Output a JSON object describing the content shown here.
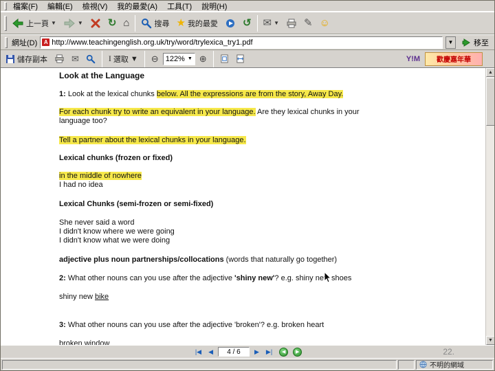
{
  "menu_bar": {
    "items": [
      {
        "label": "檔案(F)"
      },
      {
        "label": "編輯(E)"
      },
      {
        "label": "檢視(V)"
      },
      {
        "label": "我的最愛(A)"
      },
      {
        "label": "工具(T)"
      },
      {
        "label": "說明(H)"
      }
    ]
  },
  "nav_toolbar": {
    "back_label": "上一頁",
    "search_label": "搜尋",
    "favorites_label": "我的最愛"
  },
  "address_bar": {
    "label": "網址(D)",
    "pdf_icon": "A",
    "url": "http://www.teachingenglish.org.uk/try/word/trylexica_try1.pdf",
    "go_label": "移至"
  },
  "pdf_toolbar": {
    "save_label": "儲存副本",
    "select_label": "選取",
    "zoom_value": "122%",
    "ym_label": "Y!M",
    "ad_text": "歡慶嘉年華"
  },
  "pdf_nav": {
    "page_indicator": "4 / 6"
  },
  "slide_number": "22.",
  "status_bar": {
    "zone_text": "不明的網域"
  },
  "document": {
    "lines": [
      {
        "h": 1,
        "mt": 0,
        "runs": [
          {
            "t": "Look at the Language",
            "b": 1
          }
        ]
      },
      {
        "mt": 14,
        "runs": [
          {
            "t": "1: ",
            "b": 1
          },
          {
            "t": "Look at the lexical chunks "
          },
          {
            "t": "below. All the expressions are from the story, Away Day.",
            "hl": 1
          }
        ]
      },
      {
        "mt": 13,
        "runs": [
          {
            "t": "For each chunk try to write an equivalent in your language.",
            "hl": 1
          },
          {
            "t": " Are they lexical chunks in your"
          }
        ]
      },
      {
        "mt": 0,
        "runs": [
          {
            "t": "language too?"
          }
        ]
      },
      {
        "mt": 15,
        "runs": [
          {
            "t": "Tell a partner about the lexical chunks in your language.",
            "hl": 1
          }
        ]
      },
      {
        "mt": 13,
        "runs": [
          {
            "t": "Lexical chunks (frozen or fixed)",
            "b": 1
          }
        ]
      },
      {
        "mt": 13,
        "runs": [
          {
            "t": "in the middle of nowhere",
            "hl": 1
          }
        ]
      },
      {
        "mt": 0,
        "runs": [
          {
            "t": "I had no idea"
          }
        ]
      },
      {
        "mt": 15,
        "runs": [
          {
            "t": "Lexical Chunks (semi-frozen or semi-fixed)",
            "b": 1
          }
        ]
      },
      {
        "mt": 14,
        "runs": [
          {
            "t": "She never said a word"
          }
        ]
      },
      {
        "mt": 0,
        "runs": [
          {
            "t": "I didn't know where we were going"
          }
        ]
      },
      {
        "mt": 0,
        "runs": [
          {
            "t": "I didn't know what we were doing"
          }
        ]
      },
      {
        "mt": 15,
        "runs": [
          {
            "t": "adjective plus noun partnerships/collocations",
            "b": 1
          },
          {
            "t": " (words that naturally go together)"
          }
        ]
      },
      {
        "mt": 14,
        "runs": [
          {
            "t": "2: ",
            "b": 1
          },
          {
            "t": "What other nouns can you use after the adjective "
          },
          {
            "t": "'shiny new'",
            "b": 1
          },
          {
            "t": "? e.g. shiny new shoes"
          }
        ]
      },
      {
        "mt": 14,
        "runs": [
          {
            "t": "shiny new "
          },
          {
            "t": "bike",
            "ul": 1
          }
        ]
      },
      {
        "mt": 28,
        "runs": [
          {
            "t": "3: ",
            "b": 1
          },
          {
            "t": "What other nouns can you use after the adjective 'broken'? e.g. broken heart"
          }
        ]
      },
      {
        "mt": 14,
        "runs": [
          {
            "t": "broken",
            "ul": 1
          },
          {
            "t": " window"
          }
        ]
      }
    ]
  }
}
